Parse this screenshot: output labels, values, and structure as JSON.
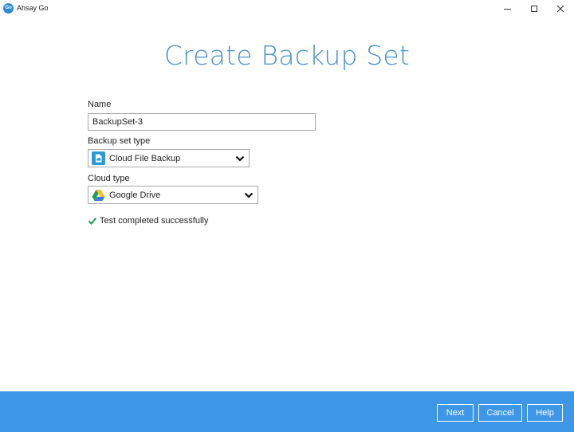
{
  "window": {
    "logo_text": "Go",
    "title": "Ahsay Go"
  },
  "page": {
    "title": "Create Backup Set"
  },
  "form": {
    "name_label": "Name",
    "name_value": "BackupSet-3",
    "backup_type_label": "Backup set type",
    "backup_type_value": "Cloud File Backup",
    "cloud_type_label": "Cloud type",
    "cloud_type_value": "Google Drive"
  },
  "status": {
    "text": "Test completed successfully",
    "color": "#1a9e5c"
  },
  "footer": {
    "next_label": "Next",
    "cancel_label": "Cancel",
    "help_label": "Help",
    "background": "#3d96e6"
  },
  "icons": {
    "backup_type": "cloud-file-backup-icon",
    "cloud_type": "google-drive-icon",
    "dropdown": "chevron-down-icon",
    "status": "checkmark-icon"
  }
}
